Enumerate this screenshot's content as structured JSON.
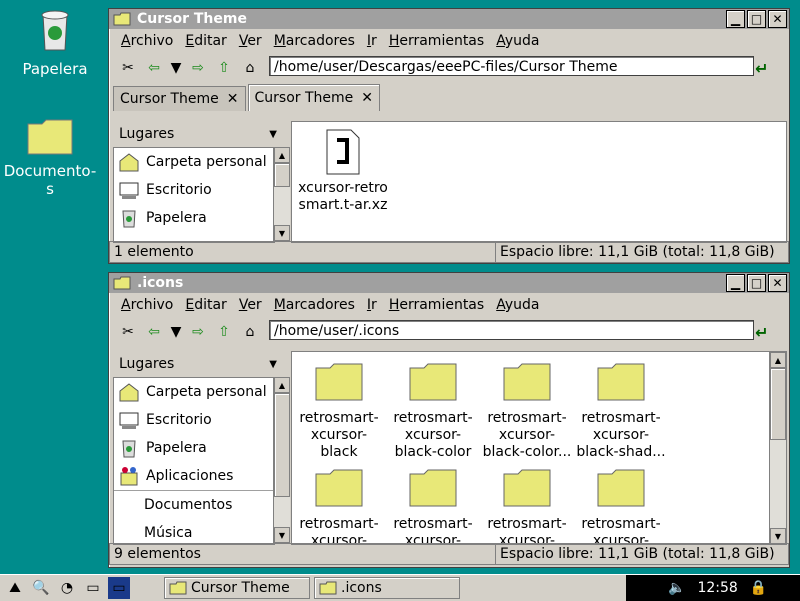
{
  "desktop": {
    "icons": [
      {
        "label": "Papelera"
      },
      {
        "label": "Documento-s"
      }
    ]
  },
  "window1": {
    "title": "Cursor Theme",
    "menu": [
      "Archivo",
      "Editar",
      "Ver",
      "Marcadores",
      "Ir",
      "Herramientas",
      "Ayuda"
    ],
    "location": "/home/user/Descargas/eeePC-files/Cursor Theme",
    "tabs": [
      {
        "label": "Cursor Theme",
        "active": false
      },
      {
        "label": "Cursor Theme",
        "active": true
      }
    ],
    "sidebar_header": "Lugares",
    "sidebar_items": [
      "Carpeta personal",
      "Escritorio",
      "Papelera"
    ],
    "files": [
      {
        "name": "xcursor-retrosmart.t-ar.xz"
      }
    ],
    "status_left": "1 elemento",
    "status_right": "Espacio libre: 11,1 GiB (total: 11,8 GiB)"
  },
  "window2": {
    "title": ".icons",
    "menu": [
      "Archivo",
      "Editar",
      "Ver",
      "Marcadores",
      "Ir",
      "Herramientas",
      "Ayuda"
    ],
    "location": "/home/user/.icons",
    "sidebar_header": "Lugares",
    "sidebar_items": [
      "Carpeta personal",
      "Escritorio",
      "Papelera",
      "Aplicaciones",
      "Documentos",
      "Música"
    ],
    "files": [
      {
        "line1": "retrosmart-",
        "line2": "xcursor-",
        "line3": "black"
      },
      {
        "line1": "retrosmart-",
        "line2": "xcursor-",
        "line3": "black-color"
      },
      {
        "line1": "retrosmart-",
        "line2": "xcursor-",
        "line3": "black-color..."
      },
      {
        "line1": "retrosmart-",
        "line2": "xcursor-",
        "line3": "black-shad..."
      },
      {
        "line1": "retrosmart-",
        "line2": "xcursor-",
        "line3": ""
      },
      {
        "line1": "retrosmart-",
        "line2": "xcursor-",
        "line3": ""
      },
      {
        "line1": "retrosmart-",
        "line2": "xcursor-",
        "line3": ""
      },
      {
        "line1": "retrosmart-",
        "line2": "xcursor-",
        "line3": ""
      }
    ],
    "status_left": "9 elementos",
    "status_right": "Espacio libre: 11,1 GiB (total: 11,8 GiB)"
  },
  "taskbar": {
    "tasks": [
      {
        "label": "Cursor Theme"
      },
      {
        "label": ".icons"
      }
    ],
    "clock": "12:58"
  },
  "colors": {
    "desktop": "#008c8c",
    "folder": "#e8e878",
    "titlebar": "#a0a0a0"
  }
}
